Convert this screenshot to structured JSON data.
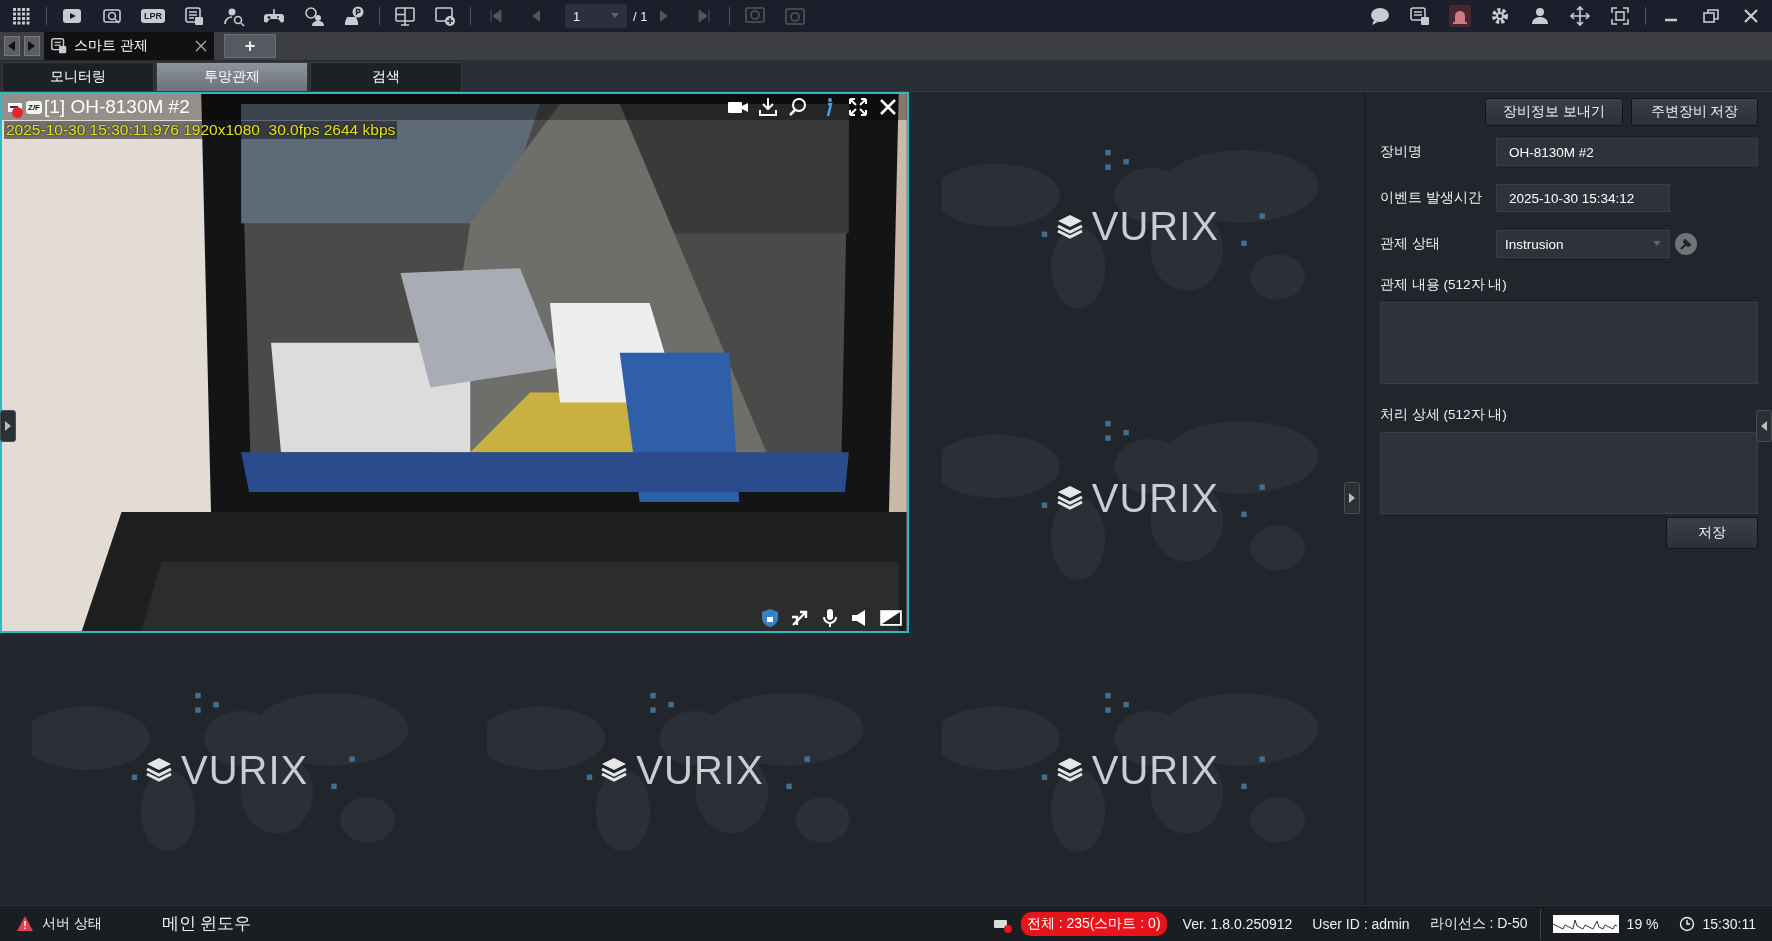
{
  "toolbar": {
    "lpr_label": "LPR",
    "page_value": "1",
    "page_total": "/ 1"
  },
  "workspace_tabs": {
    "tabs": [
      {
        "label": "스마트 관제",
        "selected": true
      }
    ],
    "add_label": "+"
  },
  "view_tabs": [
    {
      "label": "모니터링",
      "selected": false
    },
    {
      "label": "투망관제",
      "selected": true
    },
    {
      "label": "검색",
      "selected": false
    }
  ],
  "video_grid": {
    "cells": [
      {
        "kind": "video",
        "selected": true,
        "title": "[1] OH-8130M #2",
        "zf_label": "Z/F",
        "recording": true,
        "overlay": "2025-10-30 15:30:11.976 1920x1080  30.0fps 2644 kbps"
      },
      {
        "kind": "empty",
        "logo": "VURIX"
      },
      {
        "kind": "empty",
        "logo": "VURIX"
      },
      {
        "kind": "empty",
        "logo": "VURIX"
      },
      {
        "kind": "empty",
        "logo": "VURIX"
      },
      {
        "kind": "empty",
        "logo": "VURIX"
      }
    ]
  },
  "side_panel": {
    "buttons": [
      "장비정보 보내기",
      "주변장비 저장"
    ],
    "fields": [
      {
        "kind": "text",
        "label": "장비명",
        "value": "OH-8130M #2"
      },
      {
        "kind": "time",
        "label": "이벤트 발생시간",
        "value": "2025-10-30 15:34:12"
      },
      {
        "kind": "select",
        "label": "관제 상태",
        "value": "Instrusion"
      },
      {
        "kind": "textarea",
        "label": "관제 내용 (512자 내)"
      },
      {
        "kind": "textarea",
        "label": "처리 상세 (512자 내)"
      }
    ],
    "save_label": "저장"
  },
  "status_bar": {
    "server_status": "서버 상태",
    "window_name": "메인 윈도우",
    "device_count": "전체 : 235(스마트 : 0)",
    "version": "Ver. 1.8.0.250912",
    "user": "User ID : admin",
    "license": "라이선스 : D-50",
    "cpu": "19 %",
    "time": "15:30:11"
  }
}
